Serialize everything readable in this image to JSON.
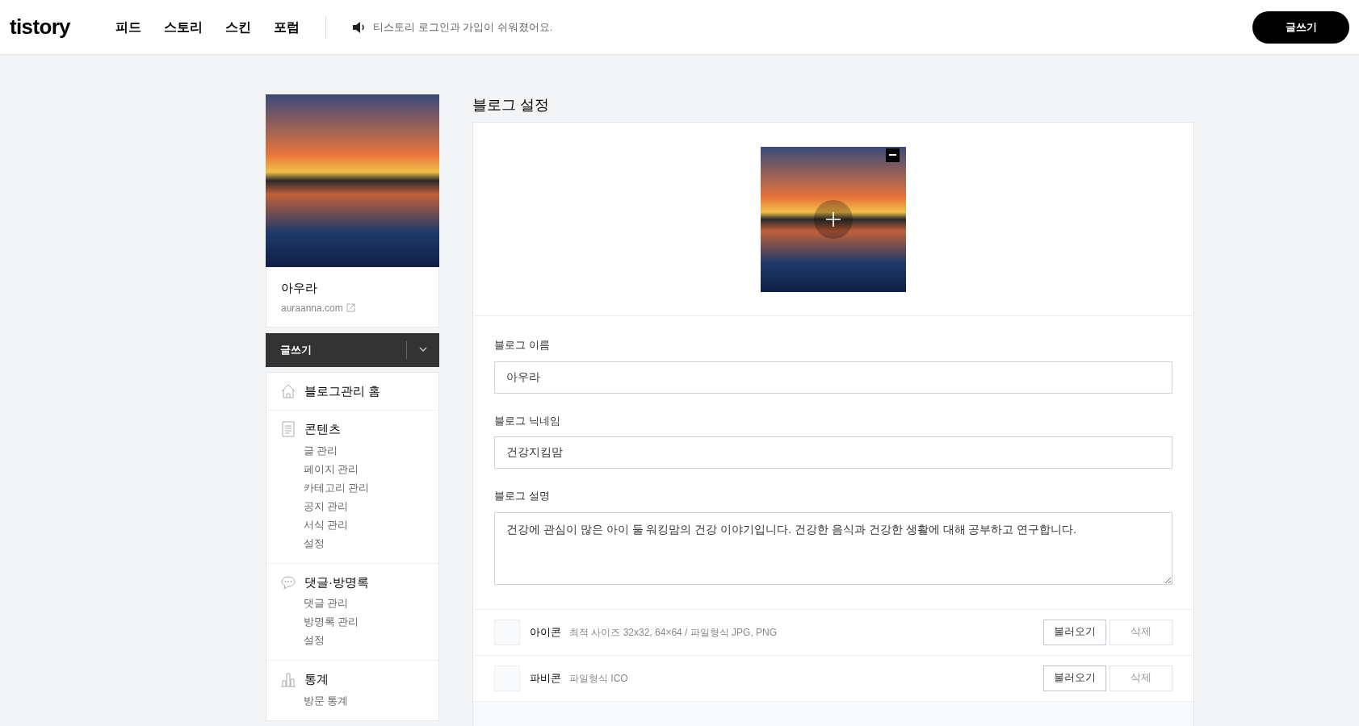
{
  "header": {
    "logo": "tistory",
    "nav": [
      "피드",
      "스토리",
      "스킨",
      "포럼"
    ],
    "notice": "티스토리 로그인과 가입이 쉬워졌어요.",
    "write_button": "글쓰기"
  },
  "sidebar": {
    "blog_name": "아우라",
    "blog_url": "auraanna.com",
    "write_button": "글쓰기",
    "sections": [
      {
        "kind": "home",
        "title": "블로그관리 홈"
      },
      {
        "kind": "document",
        "title": "콘텐츠",
        "items": [
          "글 관리",
          "페이지 관리",
          "카테고리 관리",
          "공지 관리",
          "서식 관리",
          "설정"
        ]
      },
      {
        "kind": "comment",
        "title": "댓글·방명록",
        "items": [
          "댓글 관리",
          "방명록 관리",
          "설정"
        ]
      },
      {
        "kind": "chart",
        "title": "통계",
        "items": [
          "방문 통계"
        ]
      }
    ]
  },
  "main": {
    "title": "블로그 설정",
    "fields": [
      {
        "kind": "input",
        "label": "블로그 이름",
        "value": "아우라"
      },
      {
        "kind": "input",
        "label": "블로그 닉네임",
        "value": "건강지킴맘"
      },
      {
        "kind": "textarea",
        "label": "블로그 설명",
        "value": "건강에 관심이 많은 아이 둘 워킹맘의 건강 이야기입니다. 건강한 음식과 건강한 생활에 대해 공부하고 연구합니다."
      }
    ],
    "uploads": [
      {
        "label": "아이콘",
        "hint": "최적 사이즈 32x32, 64×64 / 파일형식 JPG, PNG",
        "load_button": "불러오기",
        "delete_button": "삭제"
      },
      {
        "label": "파비콘",
        "hint": "파일형식 ICO",
        "load_button": "불러오기",
        "delete_button": "삭제"
      }
    ]
  }
}
